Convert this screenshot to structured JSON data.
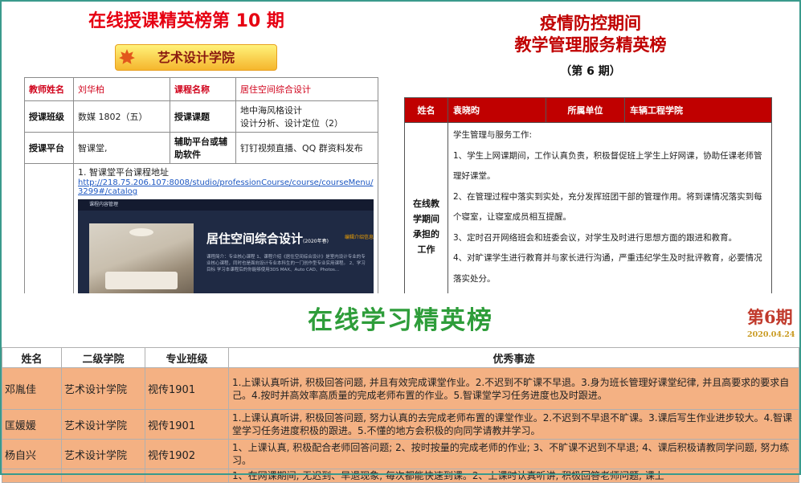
{
  "panel1": {
    "title": "在线授课精英榜第 10 期",
    "banner": "艺术设计学院",
    "rows": {
      "teacher_label": "教师姓名",
      "teacher_value": "刘华柏",
      "course_label": "课程名称",
      "course_value": "居住空间综合设计",
      "class_label": "授课班级",
      "class_value": "数媒 1802（五）",
      "topic_label": "授课课题",
      "topic_line1": "地中海风格设计",
      "topic_line2": "设计分析、设计定位（2）",
      "platform_label": "授课平台",
      "platform_value": "智课堂,",
      "aux_label": "辅助平台或辅助软件",
      "aux_value": "钉钉视频直播、QQ 群资料发布"
    },
    "link_intro": "1.  智课堂平台课程地址",
    "link_url": "http://218.75.206.107:8008/studio/professionCourse/course/courseMenu/3299#/catalog",
    "screenshot": {
      "header": "课程内容管理",
      "course_title": "居住空间综合设计",
      "course_year": "(2020年春)",
      "edit_button": "编辑介绍信息",
      "desc": "课程简介：专业核心课程 1、课程介绍《居住空间综合设计》是室内设计专业的专业核心课程，同时也是面向设计专业本科生的一门创作型专业实用课程。 2、学习目标 学习本课程后的你能够使用3DS MAX、Auto CAD、Photos..."
    }
  },
  "panel2": {
    "title_line1": "疫情防控期间",
    "title_line2": "教学管理服务精英榜",
    "issue": "（第 6 期）",
    "header": {
      "name_label": "姓名",
      "name_value": "袁晓昀",
      "unit_label": "所属单位",
      "unit_value": "车辆工程学院"
    },
    "side_label": "在线教学期间承担的工作",
    "body": [
      "学生管理与服务工作:",
      "1、学生上网课期间，工作认真负责，积极督促班上学生上好网课，协助任课老师管理好课堂。",
      "2、在管理过程中落实到实处，充分发挥班团干部的管理作用。将到课情况落实到每个寝室，让寝室成员相互提醒。",
      "3、定时召开网络班会和班委会议，对学生及时进行思想方面的跟进和教育。",
      "4、对旷课学生进行教育并与家长进行沟通，严重违纪学生及时批评教育，必要情况落实处分。"
    ]
  },
  "panel3": {
    "title": "在线学习精英榜",
    "issue": "第6期",
    "date": "2020.04.24",
    "columns": [
      "姓名",
      "二级学院",
      "专业班级",
      "优秀事迹"
    ],
    "rows": [
      {
        "name": "邓胤佳",
        "college": "艺术设计学院",
        "class": "视传1901",
        "achievement": "1.上课认真听讲, 积极回答问题, 并且有效完成课堂作业。2.不迟到不旷课不早退。3.身为班长管理好课堂纪律, 并且高要求的要求自己。4.按时并高效率高质量的完成老师布置的作业。5.智课堂学习任务进度也及时跟进。"
      },
      {
        "name": "匡媛媛",
        "college": "艺术设计学院",
        "class": "视传1901",
        "achievement": "1.上课认真听讲, 积极回答问题, 努力认真的去完成老师布置的课堂作业。2.不迟到不早退不旷课。3.课后写生作业进步较大。4.智课堂学习任务进度积极的跟进。5.不懂的地方会积极的向同学请教并学习。"
      },
      {
        "name": "杨自兴",
        "college": "艺术设计学院",
        "class": "视传1902",
        "achievement": "1、上课认真, 积极配合老师回答问题; 2、按时按量的完成老师的作业; 3、不旷课不迟到不早退; 4、课后积极请教同学问题, 努力练习。"
      },
      {
        "name": "",
        "college": "",
        "class": "",
        "achievement": "1、在网课期间, 无迟到、早退现象, 每次都能快速到课。2、上课时认真听讲, 积极回答老师问题, 课上"
      }
    ]
  },
  "colors": {
    "red": "#c00000",
    "green": "#2e9d3a",
    "row_orange": "#f4b183"
  }
}
